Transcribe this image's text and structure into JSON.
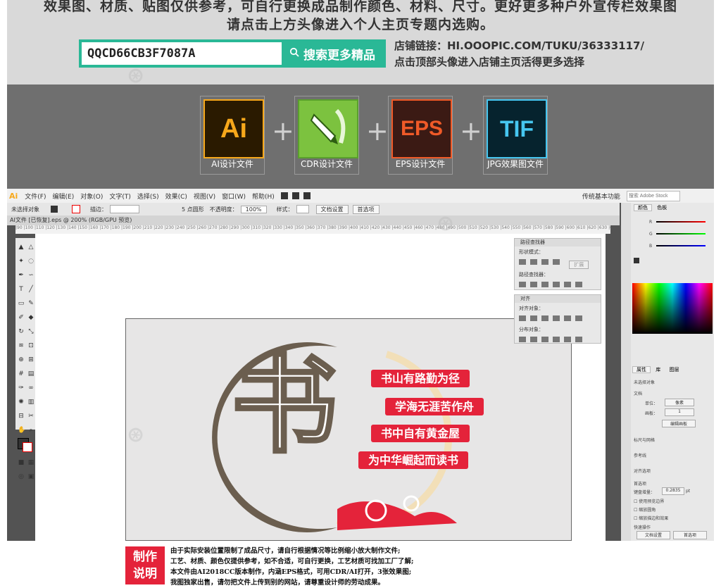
{
  "promo": {
    "line1": "效果图、材质、贴图仅供参考，可自行更换成品制作颜色、材料、尺寸。更好更多种户外宣传栏效果图",
    "line2": "请点击上方头像进入个人主页专题内选购。",
    "search_value": "QQCD66CB3F7087A",
    "search_button": "搜索更多精品",
    "shop_link_line1": "店铺链接：HI.OOOPIC.COM/TUKU/36333117/",
    "shop_link_line2": "点击顶部头像进入店铺主页活得更多选择"
  },
  "formats": [
    {
      "icon_text": "Ai",
      "label": "AI设计文件",
      "bg": "#2a1a00",
      "fg": "#f7a81b",
      "border": "#f7a81b"
    },
    {
      "icon_text": "",
      "label": "CDR设计文件",
      "bg": "#7cc23f",
      "fg": "#ffffff",
      "border": "#5aa02c"
    },
    {
      "icon_text": "EPS",
      "label": "EPS设计文件",
      "bg": "#3b1a14",
      "fg": "#f05a28",
      "border": "#f05a28"
    },
    {
      "icon_text": "TIF",
      "label": "JPG效果图文件",
      "bg": "#06232e",
      "fg": "#46c6f0",
      "border": "#46c6f0"
    }
  ],
  "plus_sign": "+",
  "app": {
    "logo": "Ai",
    "menus": [
      "文件(F)",
      "编辑(E)",
      "对象(O)",
      "文字(T)",
      "选择(S)",
      "效果(C)",
      "视图(V)",
      "窗口(W)",
      "帮助(H)"
    ],
    "workspace": "传统基本功能",
    "search_placeholder": "搜索 Adobe Stock",
    "control_bar": {
      "selection": "未选择对象",
      "stroke_label": "描边：",
      "brush": "5 点圆形",
      "opacity_label": "不透明度：",
      "opacity_value": "100%",
      "style_label": "样式：",
      "doc_setup": "文档设置",
      "prefs": "首选项"
    },
    "doc_tab": "AI文件 [已恢复].eps @ 200% (RGB/GPU 预览)",
    "ruler": "|90 |100 |110 |120 |130 |140 |150 |160 |170 |180 |190 |200 |210 |220 |230 |240 |250 |260 |270 |280 |290 |300 |310 |320 |330 |340 |350 |360 |370 |380 |390 |400 |410 |420 |430 |440 |450 |460 |470 |480 |490 |500 |510 |520 |530 |540 |550 |560 |570 |580 |590 |600 |610 |620 |630 |640 |650 |660 |670 |680 |690 |700 |710 |720 |730 |740"
  },
  "artwork": {
    "big_char": "书",
    "slogans": [
      "书山有路勤为径",
      "学海无涯苦作舟",
      "书中自有黄金屋",
      "为中华崛起而读书"
    ],
    "colors": {
      "ring": "#6b5e4f",
      "red": "#e4233a",
      "moon": "#f2dfb8"
    }
  },
  "notes": {
    "badge_line1": "制作",
    "badge_line2": "说明",
    "lines": [
      "由于实际安装位置限制了成品尺寸，请自行根据情况等比例缩小放大制作文件;",
      "工艺、材质、颜色仅提供参考，如不合适，可自行更换，工艺材质可找加工厂了解;",
      "本文件由AI2018CC版本制作，内涵EPS格式，可用CDR/AI打开，3张效果图;",
      "我图独家出售，请勿把文件上传到别的网站，请尊重设计师的劳动成果。"
    ]
  },
  "pathfinder_panel": {
    "title": "路径查找器",
    "shape_modes": "形状模式：",
    "expand": "扩展",
    "pathfinders": "路径查找器："
  },
  "align_panel": {
    "title": "对齐",
    "align_objects": "对齐对象：",
    "distribute_objects": "分布对象："
  },
  "right_panel": {
    "tab_color": "颜色",
    "tab_swatches": "色板",
    "channels": [
      "R",
      "G",
      "B"
    ],
    "tab_properties": "属性",
    "tab_library": "库",
    "tab_layers": "图层",
    "no_selection": "未选择对象",
    "document": "文档",
    "units_label": "单位：",
    "units_value": "像素",
    "artboard_label": "画板：",
    "artboard_value": "1",
    "edit_artboards": "编辑画板",
    "ruler_grid": "标尺与网格",
    "guides": "参考线",
    "snap": "对齐选项",
    "preferences": "首选项",
    "keyboard_increment_label": "键盘增量：",
    "keyboard_increment_value": "0.2835",
    "keyboard_increment_unit": "pt",
    "checks": [
      "使用预览边界",
      "缩放圆角",
      "缩放描边和效果"
    ],
    "quick_actions": "快速操作",
    "doc_setup": "文档设置",
    "prefs_btn": "首选项"
  }
}
